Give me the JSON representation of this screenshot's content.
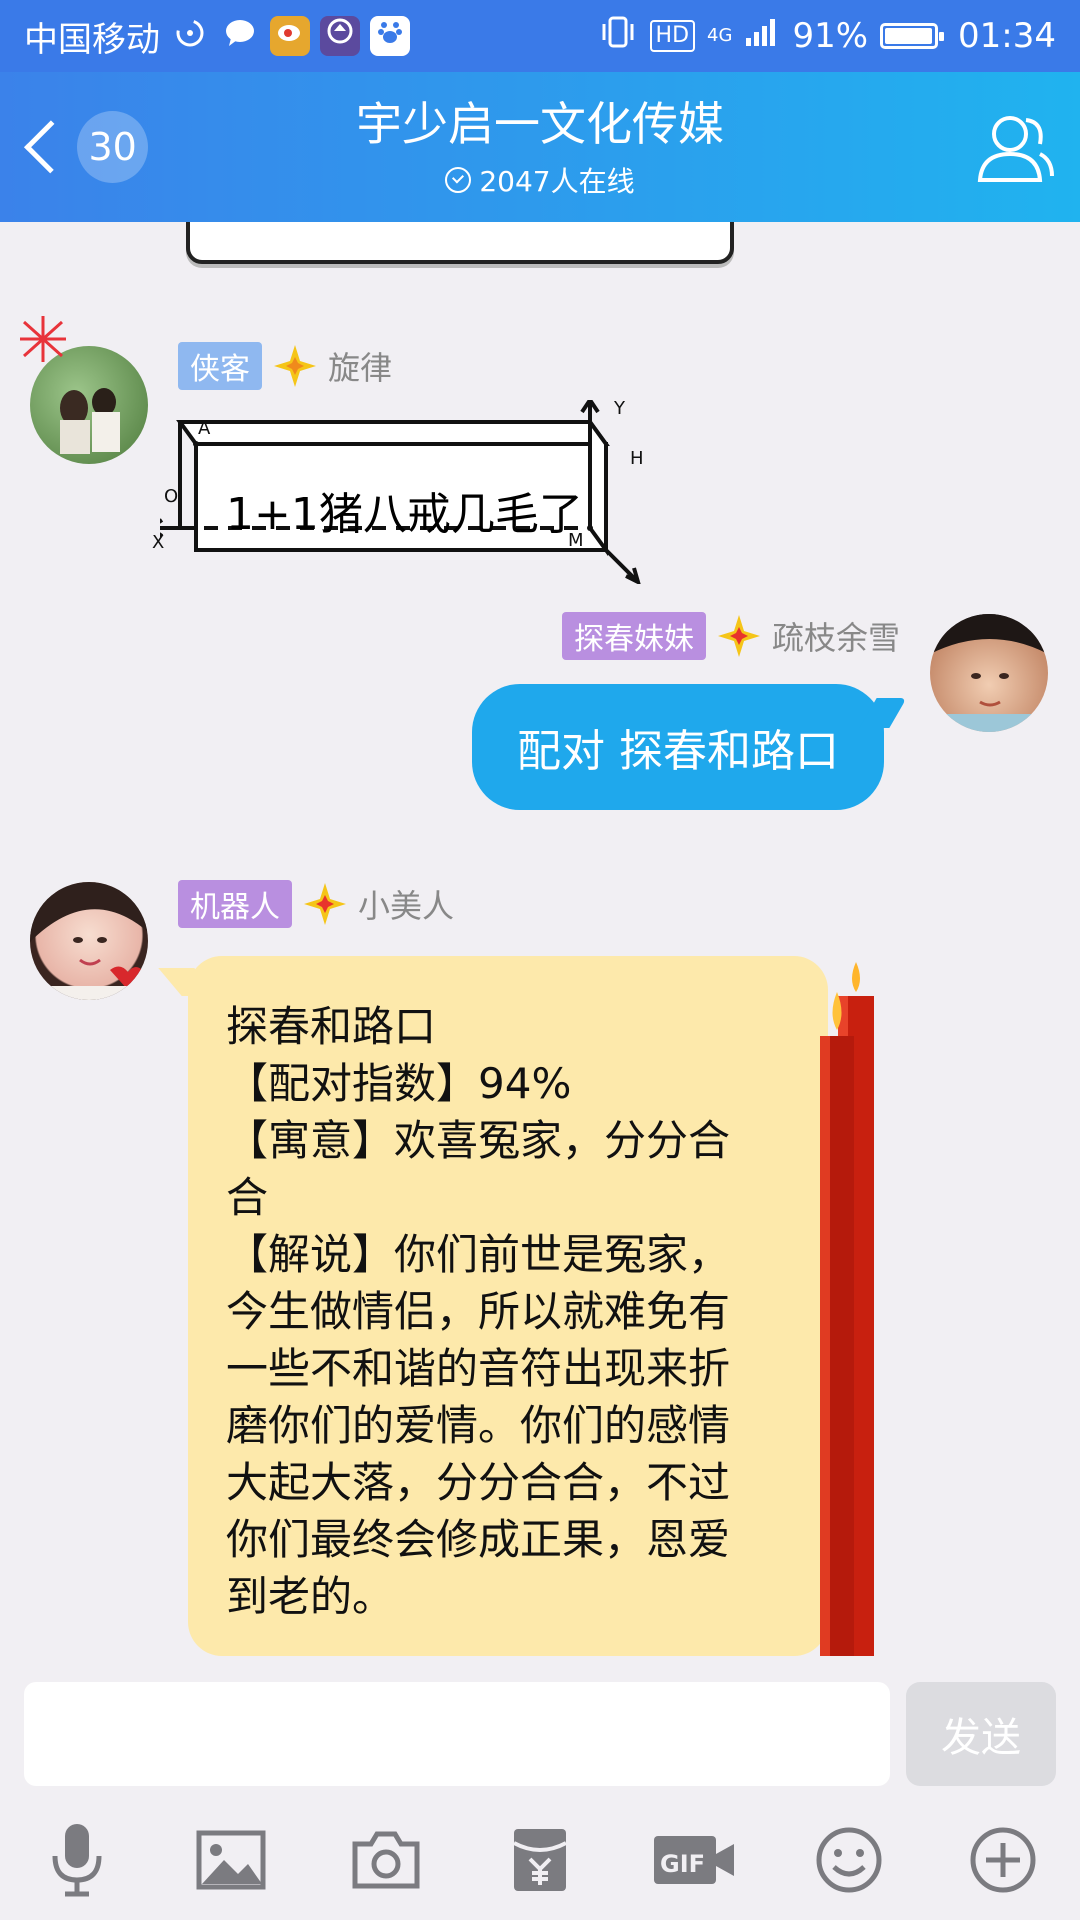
{
  "status_bar": {
    "carrier": "中国移动",
    "network": "4G",
    "hd": "HD",
    "battery_percent": "91%",
    "battery_level": 0.91,
    "time": "01:34"
  },
  "header": {
    "back_count": "30",
    "title": "宇少启一文化传媒",
    "online": "2047人在线"
  },
  "messages": [
    {
      "tag": "侠客",
      "tag_color": "#8fb8f0",
      "name": "旋律",
      "text": "1+1猪八戒几毛了"
    },
    {
      "tag": "探春妹妹",
      "tag_color": "#b98fe0",
      "name": "疏枝余雪",
      "text": "配对 探春和路口"
    },
    {
      "tag": "机器人",
      "tag_color": "#b98fe0",
      "name": "小美人",
      "lines": [
        "探春和路口",
        "【配对指数】94%",
        "【寓意】欢喜冤家，分分合",
        "合",
        "【解说】你们前世是冤家，",
        "今生做情侣，所以就难免有",
        "一些不和谐的音符出现来折",
        "磨你们的爱情。你们的感情",
        "大起大落，分分合合，不过",
        "你们最终会修成正果，恩爱",
        "到老的。"
      ]
    }
  ],
  "diagram_labels": {
    "a": "A",
    "y": "Y",
    "h": "H",
    "o": "O",
    "x": "X",
    "m": "M"
  },
  "input": {
    "placeholder": "",
    "send_label": "发送"
  },
  "toolbar": [
    "mic-icon",
    "image-icon",
    "camera-icon",
    "red-packet-icon",
    "gif-icon",
    "emoji-icon",
    "plus-icon"
  ],
  "colors": {
    "header_start": "#3b82ea",
    "header_end": "#20b3ef",
    "self_bubble": "#1fa8ec",
    "robot_bubble": "#fde9ab",
    "background": "#f1eff3"
  }
}
